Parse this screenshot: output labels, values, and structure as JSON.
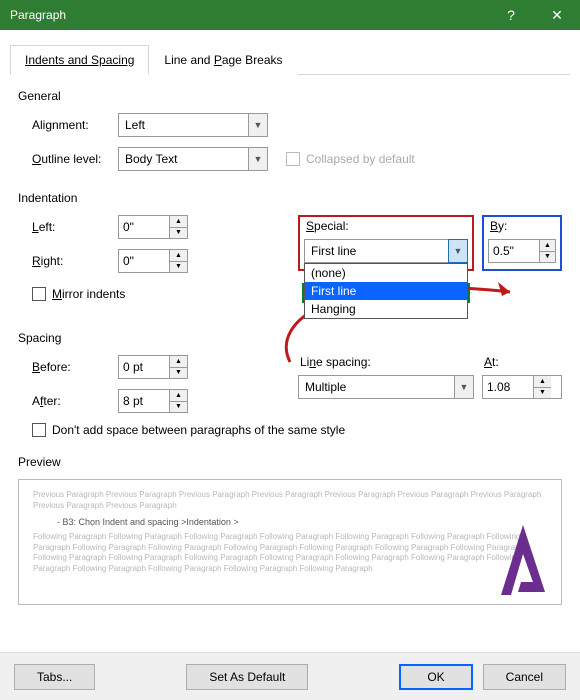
{
  "window": {
    "title": "Paragraph",
    "help": "?",
    "close": "✕"
  },
  "tabs": {
    "t1": "Indents and Spacing",
    "t2_pre": "Line and ",
    "t2_u": "P",
    "t2_post": "age Breaks"
  },
  "general": {
    "heading": "General",
    "alignment_label_u": "Alignment:",
    "alignment_value": "Left",
    "outline_label_pre": "O",
    "outline_label_post": "utline level:",
    "outline_value": "Body Text",
    "collapsed_label": "Collapsed by default"
  },
  "indentation": {
    "heading": "Indentation",
    "left_label_u": "L",
    "left_label_post": "eft:",
    "left_value": "0\"",
    "right_label_u": "R",
    "right_label_post": "ight:",
    "right_value": "0\"",
    "special_label_u": "S",
    "special_label_post": "pecial:",
    "special_value": "First line",
    "options": {
      "o1": "(none)",
      "o2": "First line",
      "o3": "Hanging"
    },
    "by_label_u": "B",
    "by_label_post": "y:",
    "by_value": "0.5\"",
    "mirror_label_u": "M",
    "mirror_label_post": "irror indents"
  },
  "spacing": {
    "heading": "Spacing",
    "before_label_u": "B",
    "before_label_post": "efore:",
    "before_value": "0 pt",
    "after_label_pre": "A",
    "after_label_u": "f",
    "after_label_post": "ter:",
    "after_value": "8 pt",
    "line_label_pre": "Li",
    "line_label_u": "n",
    "line_label_post": "e spacing:",
    "line_value": "Multiple",
    "at_label_u": "A",
    "at_label_post": "t:",
    "at_value": "1.08",
    "nospace_label": "Don't add space between paragraphs of the same style"
  },
  "preview": {
    "heading": "Preview",
    "before_text": "Previous Paragraph Previous Paragraph Previous Paragraph Previous Paragraph Previous Paragraph Previous Paragraph Previous Paragraph Previous Paragraph Previous Paragraph",
    "sample": "- B3: Chọn Indent and spacing >Indentation >",
    "after_text": "Following Paragraph Following Paragraph Following Paragraph Following Paragraph Following Paragraph Following Paragraph Following Paragraph Following Paragraph Following Paragraph Following Paragraph Following Paragraph Following Paragraph Following Paragraph Following Paragraph Following Paragraph Following Paragraph Following Paragraph Following Paragraph Following Paragraph Following Paragraph Following Paragraph Following Paragraph Following Paragraph Following Paragraph"
  },
  "buttons": {
    "tabs": "Tabs...",
    "default": "Set As Default",
    "ok": "OK",
    "cancel": "Cancel"
  }
}
